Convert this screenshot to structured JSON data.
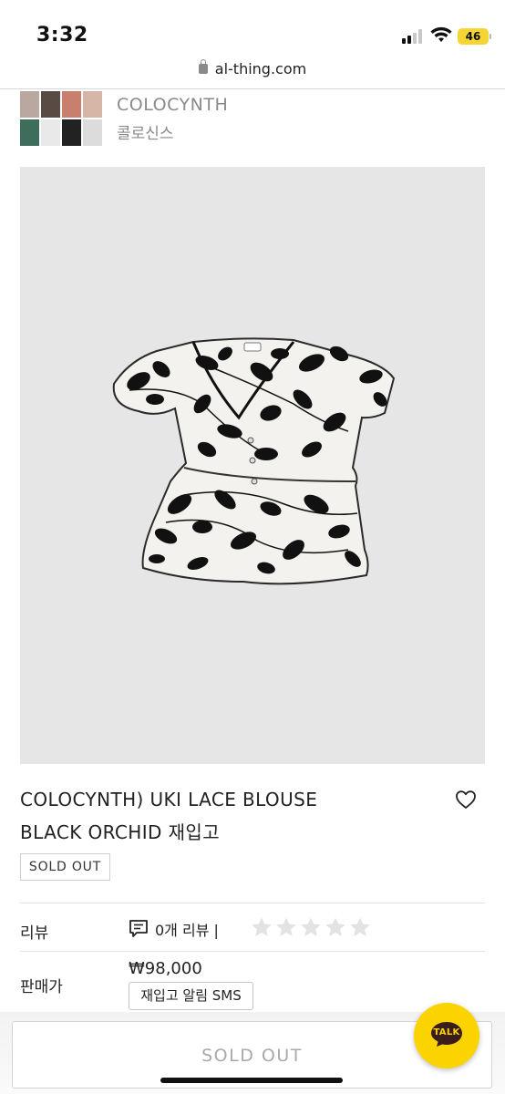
{
  "status_bar": {
    "time": "3:32",
    "battery": "46"
  },
  "url_bar": {
    "domain": "al-thing.com"
  },
  "brand": {
    "name": "COLOCYNTH",
    "name_kr": "콜로신스"
  },
  "product": {
    "title_line1": "COLOCYNTH) UKI LACE BLOUSE",
    "title_line2": "BLACK ORCHID 재입고",
    "status_badge": "SOLD OUT"
  },
  "info": {
    "review_label": "리뷰",
    "review_text": "0개 리뷰 |",
    "rating": 0,
    "rating_max": 5,
    "price_label": "판매가",
    "price": "₩98,000",
    "restock_button": "재입고 알림 SMS"
  },
  "bottom": {
    "sold_out_button": "SOLD OUT",
    "talk_button": "TALK"
  },
  "colors": {
    "talk_yellow": "#fbd400",
    "battery_yellow": "#f5d533",
    "star_empty": "#e3e3e3"
  }
}
